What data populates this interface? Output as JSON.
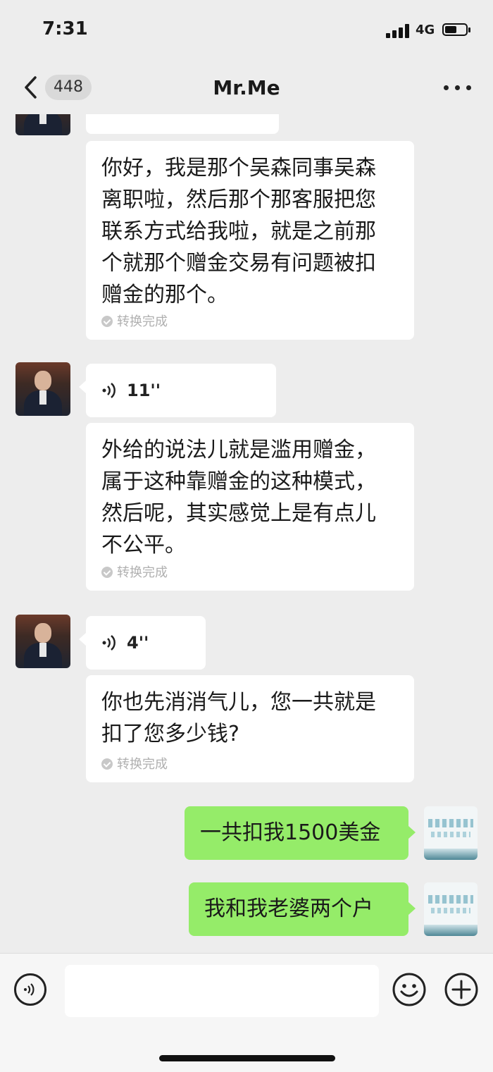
{
  "status_bar": {
    "time": "7:31",
    "network": "4G"
  },
  "header": {
    "unread_count": "448",
    "title": "Mr.Me"
  },
  "messages": [
    {
      "text": "你好，我是那个吴森同事吴森\n离职啦，然后那个那客服把您\n联系方式给我啦，就是之前那\n个就那个赠金交易有问题被扣\n赠金的那个。",
      "status": "转换完成"
    },
    {
      "voice_duration": "11''",
      "text": "外给的说法儿就是滥用赠金，\n属于这种靠赠金的这种模式，\n然后呢，其实感觉上是有点儿\n不公平。",
      "status": "转换完成"
    },
    {
      "voice_duration": "4''",
      "text": "你也先消消气儿，您一共就是\n扣了您多少钱?",
      "status": "转换完成"
    }
  ],
  "my_messages": [
    {
      "text": "一共扣我1500美金"
    },
    {
      "text": "我和我老婆两个户"
    }
  ],
  "icons": {
    "back": "chevron-left-icon",
    "more": "more-dots-icon",
    "voice": "voice-wave-icon",
    "emoji": "smiley-icon",
    "plus": "plus-circle-icon"
  },
  "colors": {
    "background": "#ededed",
    "my_bubble": "#95ec69",
    "their_bubble": "#ffffff"
  }
}
